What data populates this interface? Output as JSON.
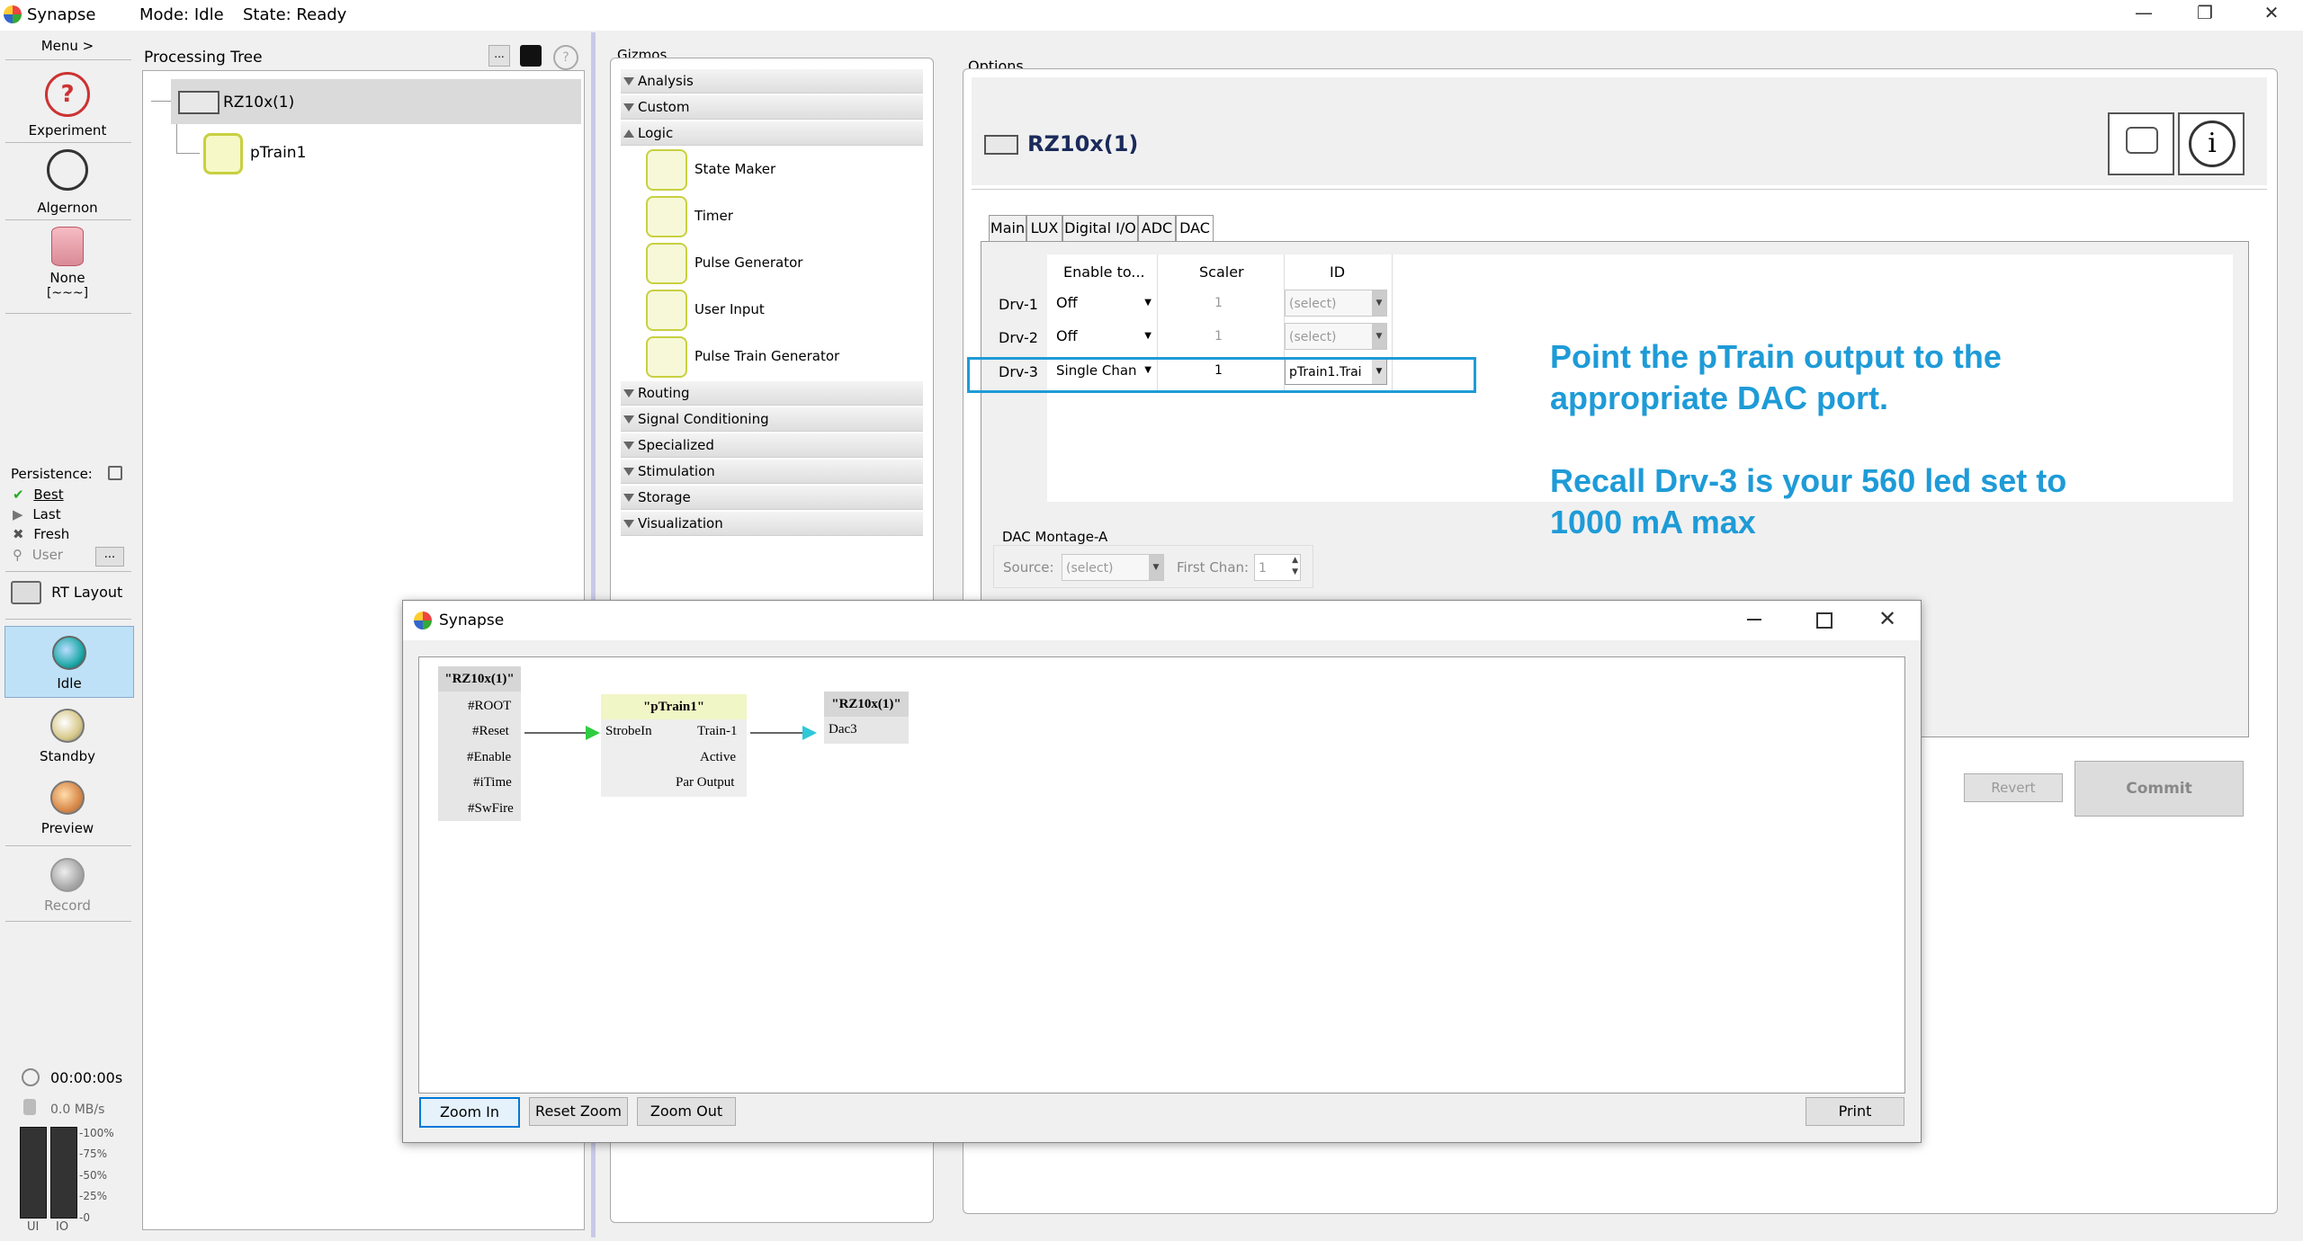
{
  "app": {
    "title": "Synapse",
    "mode": "Mode: Idle",
    "state": "State: Ready",
    "win_min": "—",
    "win_restore": "❐",
    "win_close": "✕"
  },
  "left_toolbar": {
    "menu": "Menu >",
    "experiment": "Experiment",
    "algernon": "Algernon",
    "none": "None",
    "none_sub": "[~~~]",
    "persistence_label": "Persistence:",
    "persistence": [
      {
        "label": "Best",
        "icon": "check-icon"
      },
      {
        "label": "Last",
        "icon": "play-icon"
      },
      {
        "label": "Fresh",
        "icon": "x-icon"
      },
      {
        "label": "User",
        "icon": "search-icon"
      }
    ],
    "user_more": "...",
    "rt_layout": "RT Layout",
    "idle": "Idle",
    "standby": "Standby",
    "preview": "Preview",
    "record": "Record",
    "timer": "00:00:00s",
    "rate": "0.0 MB/s",
    "meter_ticks": [
      "-100%",
      "-75%",
      "-50%",
      "-25%",
      "-0"
    ],
    "meter_labels": [
      "UI",
      "IO"
    ]
  },
  "processing_tree": {
    "title": "Processing Tree",
    "btn_more": "...",
    "btn_help": "?",
    "root": "RZ10x(1)",
    "child": "pTrain1"
  },
  "gizmos": {
    "title": "Gizmos",
    "categories_top": [
      {
        "label": "Analysis",
        "open": false
      },
      {
        "label": "Custom",
        "open": false
      },
      {
        "label": "Logic",
        "open": true
      }
    ],
    "logic_items": [
      "State Maker",
      "Timer",
      "Pulse Generator",
      "User Input",
      "Pulse Train Generator"
    ],
    "categories_bottom": [
      "Routing",
      "Signal Conditioning",
      "Specialized",
      "Stimulation",
      "Storage",
      "Visualization"
    ]
  },
  "options": {
    "title": "Options",
    "device": "RZ10x(1)",
    "tabs": [
      "Main",
      "LUX",
      "Digital I/O",
      "ADC",
      "DAC"
    ],
    "active_tab": "DAC",
    "headers": [
      "Enable to...",
      "Scaler",
      "ID"
    ],
    "rows": [
      {
        "name": "Drv-1",
        "enable": "Off",
        "scaler": "1",
        "id": "(select)"
      },
      {
        "name": "Drv-2",
        "enable": "Off",
        "scaler": "1",
        "id": "(select)"
      },
      {
        "name": "Drv-3",
        "enable": "Single Chan",
        "scaler": "1",
        "id": "pTrain1.Trai"
      }
    ],
    "montage_title": "DAC Montage-A",
    "source_label": "Source:",
    "source_value": "(select)",
    "first_chan_label": "First Chan:",
    "first_chan_value": "1",
    "revert": "Revert",
    "commit": "Commit"
  },
  "annotation": {
    "line1": "Point the pTrain output to the",
    "line2": "appropriate DAC port.",
    "line3": "Recall Drv-3 is your 560 led set to",
    "line4": "1000 mA max",
    "color": "#1e9bd7"
  },
  "dialog": {
    "title": "Synapse",
    "node_rz_title": "\"RZ10x(1)\"",
    "node_rz_ports": [
      "#ROOT",
      "#Reset",
      "#Enable",
      "#iTime",
      "#SwFire"
    ],
    "node_ptrain_title": "\"pTrain1\"",
    "node_ptrain_in": "StrobeIn",
    "node_ptrain_outs": [
      "Train-1",
      "Active",
      "Par Output"
    ],
    "node_dac_title": "\"RZ10x(1)\"",
    "node_dac_port": "Dac3",
    "zoom_in": "Zoom In",
    "reset_zoom": "Reset Zoom",
    "zoom_out": "Zoom Out",
    "print": "Print"
  }
}
